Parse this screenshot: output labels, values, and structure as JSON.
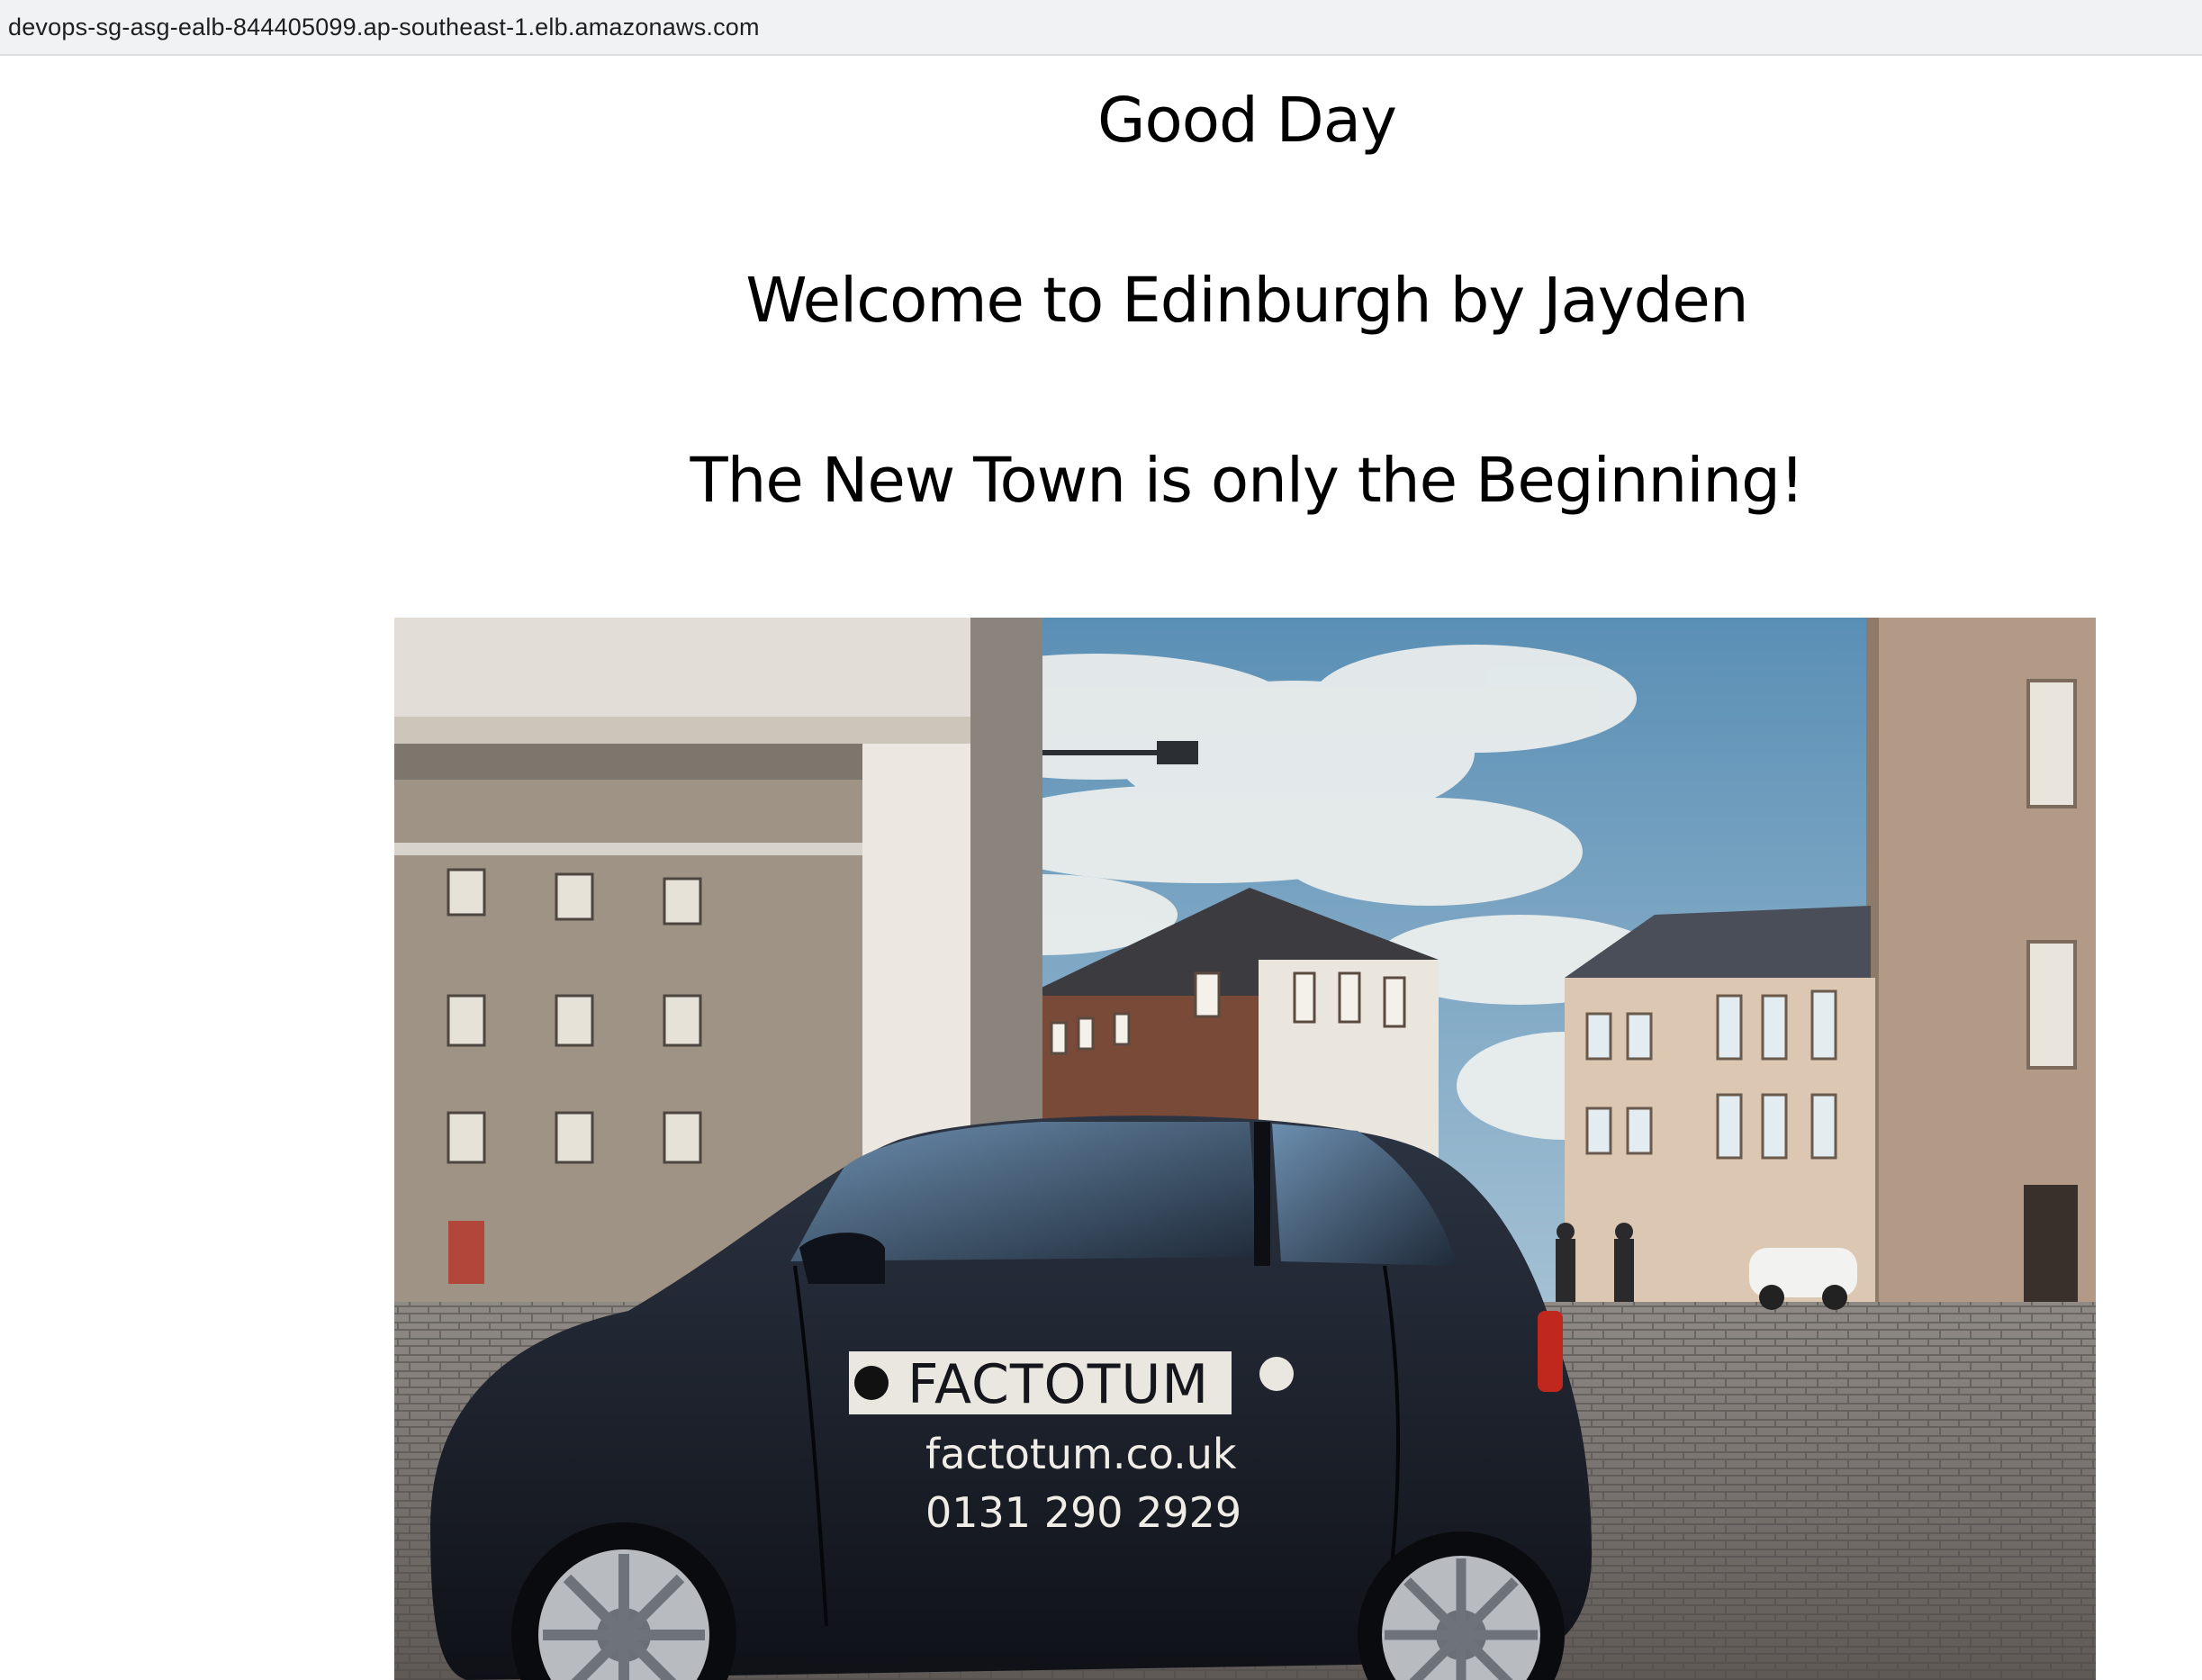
{
  "browser": {
    "url": "devops-sg-asg-ealb-844405099.ap-southeast-1.elb.amazonaws.com"
  },
  "page": {
    "greeting": "Good Day",
    "welcome": "Welcome to Edinburgh by Jayden",
    "tagline": "The New Town is only the Beginning!"
  },
  "photo": {
    "car_brand": "FACTOTUM",
    "car_website": "factotum.co.uk",
    "car_phone": "0131 290 2929",
    "reflection_text": "0131"
  }
}
